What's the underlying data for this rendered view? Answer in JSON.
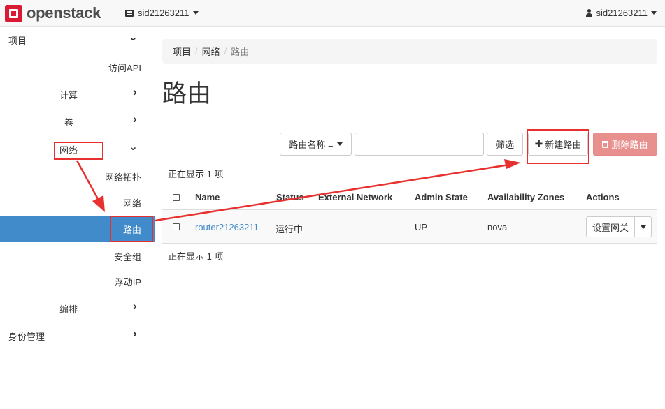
{
  "brand": {
    "logo_text": "openstack"
  },
  "navbar": {
    "project": "sid21263211",
    "user": "sid21263211"
  },
  "sidebar": {
    "project": "项目",
    "api_access": "访问API",
    "compute": "计算",
    "volumes": "卷",
    "network": "网络",
    "network_topology": "网络拓扑",
    "networks": "网络",
    "routers": "路由",
    "security_groups": "安全组",
    "floating_ips": "浮动IP",
    "orchestration": "编排",
    "identity": "身份管理"
  },
  "breadcrumb": {
    "item1": "项目",
    "item2": "网络",
    "item3": "路由",
    "separator": "/"
  },
  "page": {
    "title": "路由"
  },
  "toolbar": {
    "filter_field": "路由名称 =",
    "filter_button": "筛选",
    "create_button": "新建路由",
    "delete_button": "删除路由"
  },
  "table": {
    "count_top": "正在显示 1 项",
    "count_bottom": "正在显示 1 项",
    "headers": {
      "name": "Name",
      "status": "Status",
      "external_network": "External Network",
      "admin_state": "Admin State",
      "availability_zones": "Availability Zones",
      "actions": "Actions"
    },
    "rows": [
      {
        "name": "router21263211",
        "status": "运行中",
        "external_network": "-",
        "admin_state": "UP",
        "availability_zones": "nova",
        "action": "设置网关"
      }
    ]
  },
  "colors": {
    "accent": "#428bca",
    "annotation": "#e8302f",
    "danger": "#e8908e"
  }
}
